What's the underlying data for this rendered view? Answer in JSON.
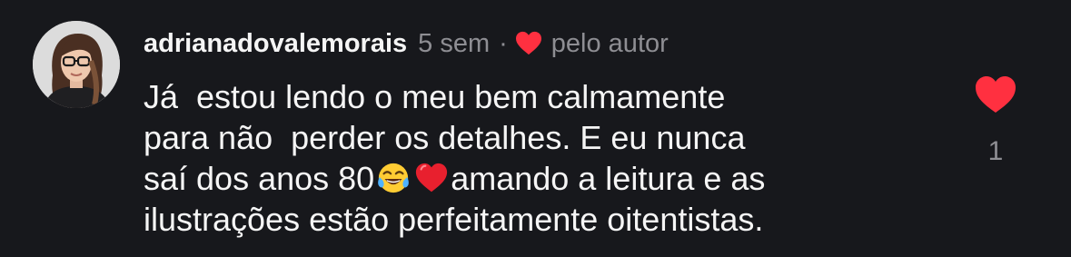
{
  "comment": {
    "author": {
      "username": "adrianadovalemorais",
      "avatar_icon": "profile-photo"
    },
    "timestamp": "5 sem",
    "separator": "·",
    "liked_by_author_icon": "heart-icon",
    "liked_by_author_label": "pelo autor",
    "text_lines": [
      "Já  estou lendo o meu bem calmamente",
      "para não  perder os detalhes. E eu nunca",
      "saí dos anos 80",
      "amando a leitura e as",
      "ilustrações estão perfeitamente oitentistas."
    ],
    "emojis": [
      "tears-of-joy-emoji",
      "red-heart-emoji"
    ],
    "like": {
      "icon": "heart-icon",
      "liked": true,
      "count": "1"
    }
  },
  "colors": {
    "background": "#17181c",
    "primary_text": "#f5f5f5",
    "secondary_text": "#8e8e93",
    "heart_red": "#ff3040"
  }
}
